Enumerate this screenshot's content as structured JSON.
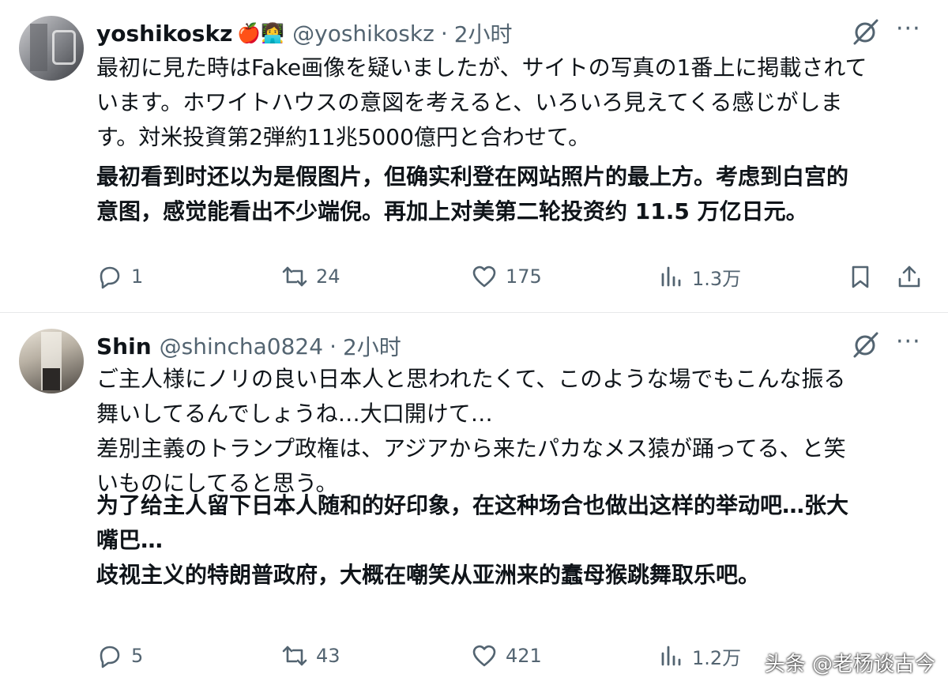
{
  "posts": [
    {
      "name": "yoshikoskz",
      "badges": "🍎👩‍💻",
      "handle": "@yoshikoskz",
      "separator": "·",
      "time": "2小时",
      "jp_lines": [
        "最初に見た時はFake画像を疑いましたが、サイトの写真の1番上に掲載されて",
        "います。ホワイトハウスの意図を考えると、いろいろ見えてくる感じがしま",
        "す。対米投資第2弾約11兆5000億円と合わせて。"
      ],
      "cn_lines": [
        "最初看到时还以为是假图片，但确实利登在网站照片的最上方。考虑到白宫的",
        "意图，感觉能看出不少端倪。再加上对美第二轮投资约 11.5 万亿日元。"
      ],
      "replies": "1",
      "reposts": "24",
      "likes": "175",
      "views": "1.3万"
    },
    {
      "name": "Shin",
      "handle": "@shincha0824",
      "separator": "·",
      "time": "2小时",
      "jp_lines": [
        "ご主人様にノリの良い日本人と思われたくて、このような場でもこんな振る",
        "舞いしてるんでしょうね…大口開けて…",
        "差別主義のトランプ政権は、アジアから来たパカなメス猿が踊ってる、と笑",
        "いものにしてると思う。"
      ],
      "cn_lines": [
        "为了给主人留下日本人随和的好印象，在这种场合也做出这样的举动吧…张大",
        "嘴巴…",
        "歧视主义的特朗普政府，大概在嘲笑从亚洲来的蠢母猴跳舞取乐吧。"
      ],
      "replies": "5",
      "reposts": "43",
      "likes": "421",
      "views": "1.2万"
    }
  ],
  "more_label": "···",
  "watermark": "头条 @老杨谈古今",
  "colors": {
    "text": "#0f1419",
    "secondary": "#536471",
    "divider": "#e7e9ea"
  },
  "icons": [
    "grok-icon",
    "more-icon",
    "reply-icon",
    "repost-icon",
    "like-icon",
    "views-icon",
    "bookmark-icon",
    "share-icon"
  ]
}
